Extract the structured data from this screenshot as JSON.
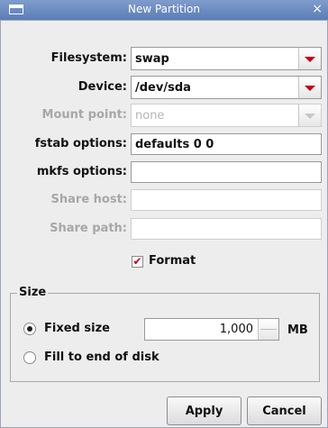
{
  "window": {
    "title": "New Partition",
    "close_glyph": "×"
  },
  "form": {
    "filesystem": {
      "label": "Filesystem:",
      "value": "swap"
    },
    "device": {
      "label": "Device:",
      "value": "/dev/sda"
    },
    "mount_point": {
      "label": "Mount point:",
      "placeholder": "none"
    },
    "fstab_options": {
      "label": "fstab options:",
      "value": "defaults 0 0"
    },
    "mkfs_options": {
      "label": "mkfs options:",
      "value": ""
    },
    "share_host": {
      "label": "Share host:",
      "value": ""
    },
    "share_path": {
      "label": "Share path:",
      "value": ""
    },
    "format": {
      "label": "Format",
      "checked": true,
      "check_glyph": "✔"
    }
  },
  "size": {
    "legend": "Size",
    "fixed_label": "Fixed size",
    "fixed_value": "1,000",
    "unit": "MB",
    "fill_label": "Fill to end of disk",
    "selected": "fixed"
  },
  "buttons": {
    "apply": "Apply",
    "cancel": "Cancel"
  },
  "colors": {
    "accent": "#c40018",
    "titlebar": "#5b7db6"
  }
}
